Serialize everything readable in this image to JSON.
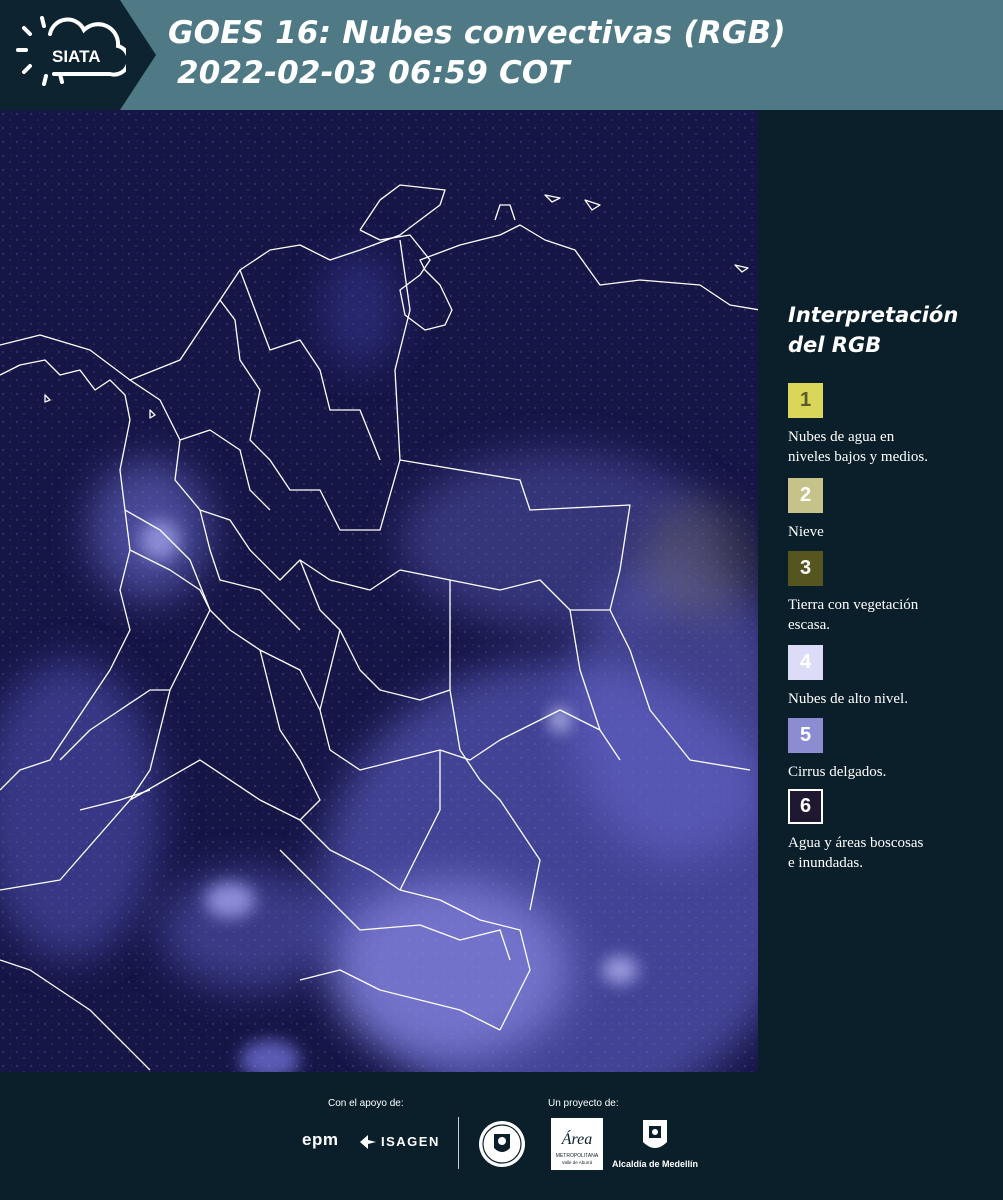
{
  "header": {
    "logo_text": "SIATA",
    "title_line1": "GOES 16: Nubes convectivas (RGB)",
    "title_line2": "2022-02-03 06:59 COT"
  },
  "legend": {
    "title_line1": "Interpretación",
    "title_line2": "del RGB",
    "items": [
      {
        "number": "1",
        "color": "#d9d65a",
        "text_color": "#5a5a2a",
        "description_line1": "Nubes de agua en",
        "description_line2": "niveles bajos y medios."
      },
      {
        "number": "2",
        "color": "#c6c38a",
        "text_color": "#ffffff",
        "description_line1": "Nieve",
        "description_line2": ""
      },
      {
        "number": "3",
        "color": "#55551f",
        "text_color": "#ffffff",
        "description_line1": "Tierra con vegetación",
        "description_line2": "escasa."
      },
      {
        "number": "4",
        "color": "#dcdcf8",
        "text_color": "#ffffff",
        "description_line1": "Nubes de alto nivel.",
        "description_line2": ""
      },
      {
        "number": "5",
        "color": "#8c8cd2",
        "text_color": "#ffffff",
        "description_line1": "Cirrus delgados.",
        "description_line2": ""
      },
      {
        "number": "6",
        "color": "#1e1830",
        "text_color": "#ffffff",
        "description_line1": "Agua y áreas boscosas",
        "description_line2": "e inundadas."
      }
    ]
  },
  "footer": {
    "support_label": "Con el apoyo de:",
    "project_label": "Un proyecto de:",
    "sponsor_1": "epm",
    "sponsor_2": "ISAGEN",
    "area_logo_text": "Área",
    "area_logo_sub1": "METROPOLITANA",
    "area_logo_sub2": "Valle de Aburrá",
    "alcaldia_label": "Alcaldía de Medellín"
  },
  "map": {
    "background_color": "#151546",
    "cloud_color": "#8a8af0",
    "boundary_color": "#ffffff"
  }
}
